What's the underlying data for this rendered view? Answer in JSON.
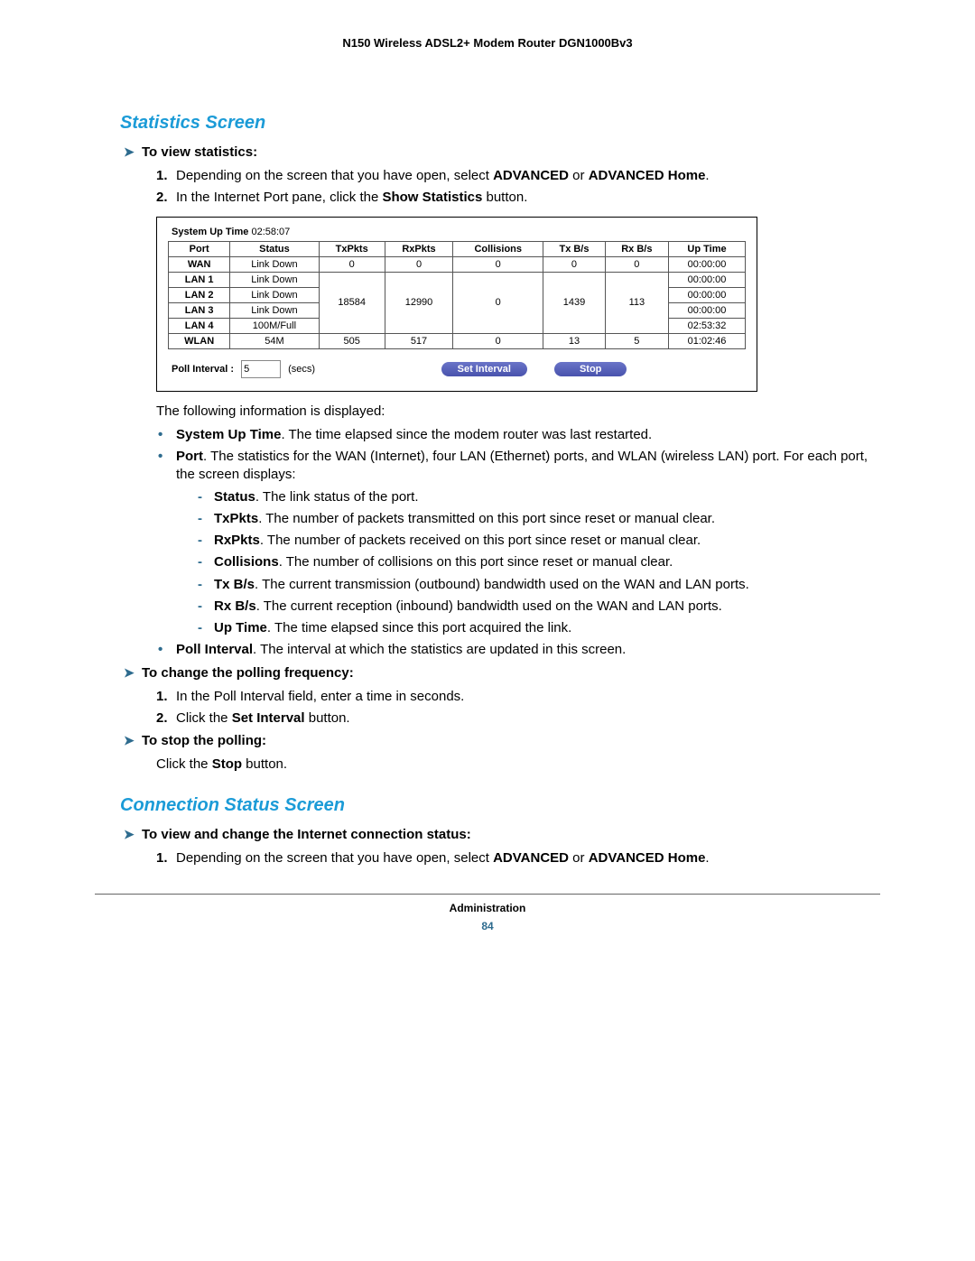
{
  "page_header": "N150 Wireless ADSL2+ Modem Router DGN1000Bv3",
  "section1_title": "Statistics Screen",
  "task1_title": "To view statistics:",
  "task1_step1_a": "Depending on the screen that you have open, select ",
  "task1_step1_b": "ADVANCED",
  "task1_step1_c": " or ",
  "task1_step1_d": "ADVANCED Home",
  "task1_step1_e": ".",
  "task1_step2_a": "In the Internet Port pane, click the ",
  "task1_step2_b": "Show Statistics",
  "task1_step2_c": " button.",
  "screenshot": {
    "system_up_label": "System Up Time",
    "system_up_value": "02:58:07",
    "headers": [
      "Port",
      "Status",
      "TxPkts",
      "RxPkts",
      "Collisions",
      "Tx B/s",
      "Rx B/s",
      "Up Time"
    ],
    "wan": {
      "port": "WAN",
      "status": "Link Down",
      "tx": "0",
      "rx": "0",
      "col": "0",
      "txb": "0",
      "rxb": "0",
      "up": "00:00:00"
    },
    "lan1": {
      "port": "LAN 1",
      "status": "Link Down",
      "up": "00:00:00"
    },
    "lan2": {
      "port": "LAN 2",
      "status": "Link Down",
      "up": "00:00:00"
    },
    "lan3": {
      "port": "LAN 3",
      "status": "Link Down",
      "up": "00:00:00"
    },
    "lan4": {
      "port": "LAN 4",
      "status": "100M/Full",
      "up": "02:53:32"
    },
    "lan_group": {
      "tx": "18584",
      "rx": "12990",
      "col": "0",
      "txb": "1439",
      "rxb": "113"
    },
    "wlan": {
      "port": "WLAN",
      "status": "54M",
      "tx": "505",
      "rx": "517",
      "col": "0",
      "txb": "13",
      "rxb": "5",
      "up": "01:02:46"
    },
    "poll_label": "Poll Interval :",
    "poll_value": "5",
    "poll_unit": "(secs)",
    "btn_set": "Set Interval",
    "btn_stop": "Stop"
  },
  "info_intro": "The following information is displayed:",
  "b_sysup_t": "System Up Time",
  "b_sysup_d": ". The time elapsed since the modem router was last restarted.",
  "b_port_t": "Port",
  "b_port_d": ". The statistics for the WAN (Internet), four LAN (Ethernet) ports, and WLAN (wireless LAN) port. For each port, the screen displays:",
  "d_status_t": "Status",
  "d_status_d": ". The link status of the port.",
  "d_tx_t": "TxPkts",
  "d_tx_d": ". The number of packets transmitted on this port since reset or manual clear.",
  "d_rx_t": "RxPkts",
  "d_rx_d": ". The number of packets received on this port since reset or manual clear.",
  "d_col_t": "Collisions",
  "d_col_d": ". The number of collisions on this port since reset or manual clear.",
  "d_txb_t": "Tx B/s",
  "d_txb_d": ". The current transmission (outbound) bandwidth used on the WAN and LAN ports.",
  "d_rxb_t": "Rx B/s",
  "d_rxb_d": ". The current reception (inbound) bandwidth used on the WAN and LAN ports.",
  "d_up_t": "Up Time",
  "d_up_d": ". The time elapsed since this port acquired the link.",
  "b_poll_t": "Poll Interval",
  "b_poll_d": ". The interval at which the statistics are updated in this screen.",
  "task2_title": "To change the polling frequency:",
  "task2_step1": "In the Poll Interval field, enter a time in seconds.",
  "task2_step2_a": "Click the ",
  "task2_step2_b": "Set Interval",
  "task2_step2_c": " button.",
  "task3_title": "To stop the polling:",
  "task3_body_a": "Click the ",
  "task3_body_b": "Stop",
  "task3_body_c": " button.",
  "section2_title": "Connection Status Screen",
  "task4_title": "To view and change the Internet connection status:",
  "task4_step1_a": "Depending on the screen that you have open, select ",
  "task4_step1_b": "ADVANCED",
  "task4_step1_c": " or ",
  "task4_step1_d": "ADVANCED Home",
  "task4_step1_e": ".",
  "footer_title": "Administration",
  "footer_page": "84",
  "num1": "1.",
  "num2": "2."
}
